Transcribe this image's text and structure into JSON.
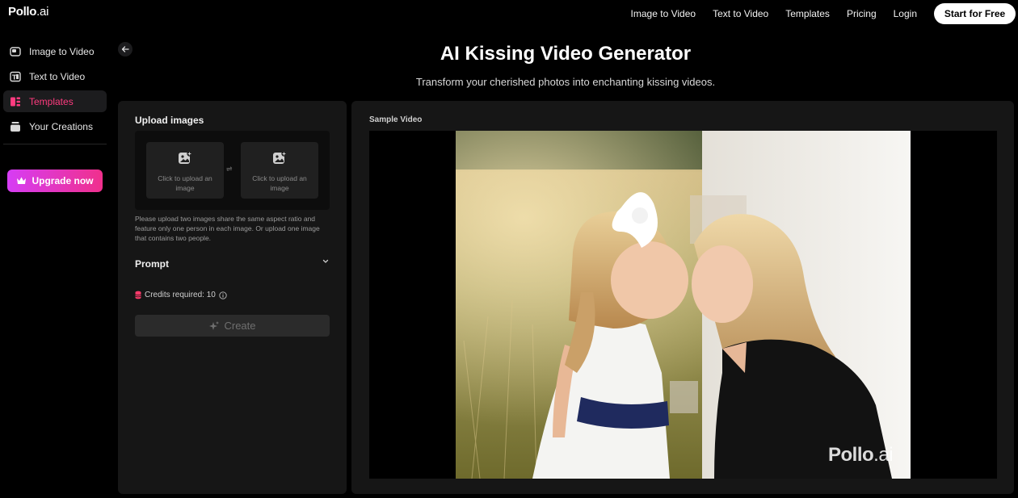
{
  "brand": {
    "name": "Pollo",
    "suffix": ".ai"
  },
  "topnav": {
    "links": [
      "Image to Video",
      "Text to Video",
      "Templates",
      "Pricing",
      "Login"
    ],
    "cta": "Start for Free"
  },
  "sidebar": {
    "items": [
      {
        "label": "Image to Video",
        "icon": "image-to-video-icon",
        "active": false
      },
      {
        "label": "Text to Video",
        "icon": "text-to-video-icon",
        "active": false
      },
      {
        "label": "Templates",
        "icon": "templates-icon",
        "active": true
      },
      {
        "label": "Your Creations",
        "icon": "creations-icon",
        "active": false
      }
    ],
    "upgrade": "Upgrade now"
  },
  "header": {
    "title": "AI Kissing Video Generator",
    "subtitle": "Transform your cherished photos into enchanting kissing videos."
  },
  "form": {
    "upload_title": "Upload images",
    "upload_box_1": "Click to upload an image",
    "upload_box_2": "Click to upload an image",
    "swap_symbol": "⇌",
    "hint": "Please upload two images share the same aspect ratio and feature only one person in each image. Or upload one image that contains two people.",
    "prompt_label": "Prompt",
    "credits": "Credits required: 10",
    "create_label": "Create"
  },
  "sample": {
    "label": "Sample Video",
    "watermark_name": "Pollo",
    "watermark_suffix": ".ai"
  },
  "colors": {
    "accent": "#ff3b7f",
    "upgrade_gradient": [
      "#d63df5",
      "#f0308c"
    ],
    "panel": "#161616",
    "background": "#000000"
  }
}
